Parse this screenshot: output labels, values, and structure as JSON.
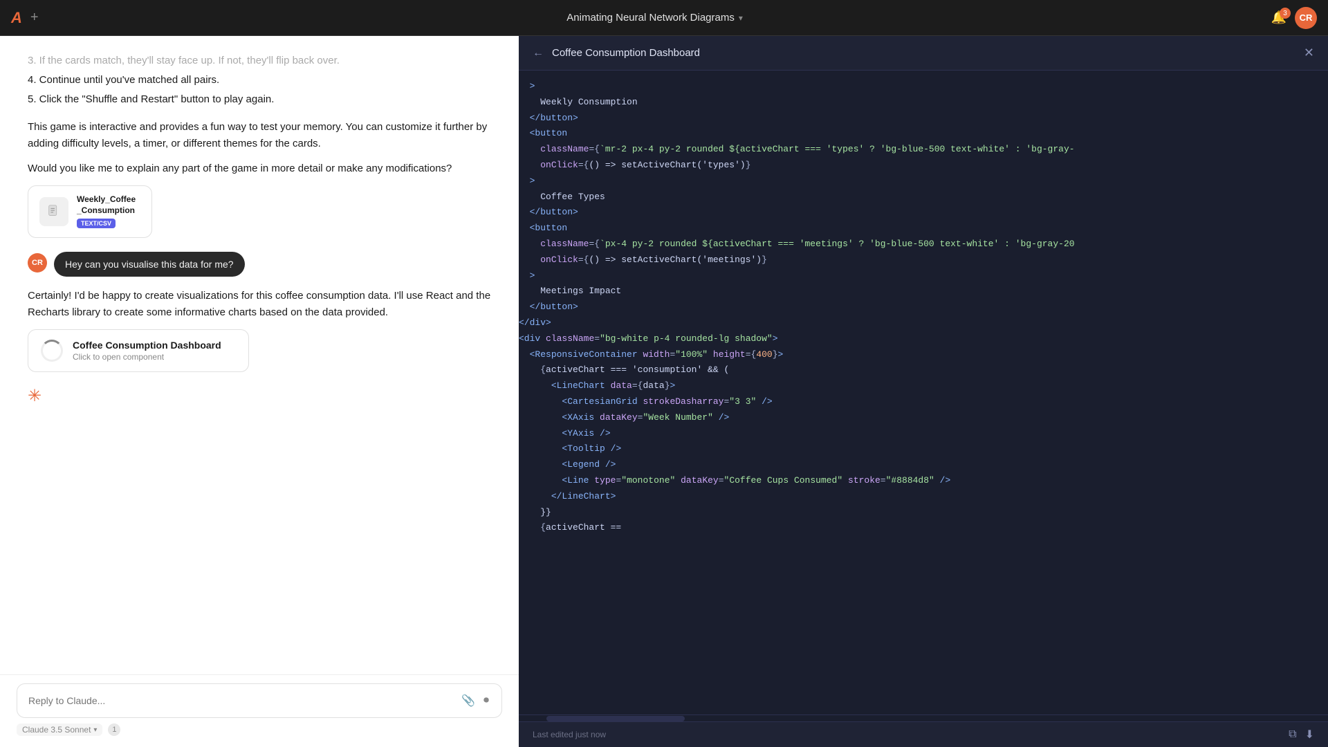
{
  "topbar": {
    "logo": "A",
    "plus_label": "+",
    "title": "Animating Neural Network Diagrams",
    "chevron": "▾",
    "notification_count": "3",
    "avatar_initials": "CR"
  },
  "chat": {
    "list_items": [
      "3. If the cards match, they'll stay face up. If not, they'll flip back over.",
      "4. Continue until you've matched all pairs.",
      "5. Click the \"Shuffle and Restart\" button to play again."
    ],
    "paragraph_1": "This game is interactive and provides a fun way to test your memory. You can customize it further by adding difficulty levels, a timer, or different themes for the cards.",
    "paragraph_2": "Would you like me to explain any part of the game in more detail or make any modifications?",
    "file_name": "Weekly_Coffee\n_Consumption",
    "file_badge": "TEXT/CSV",
    "user_message": "Hey can you visualise this data for me?",
    "user_initials": "CR",
    "response_text_1": "Certainly! I'd be happy to create visualizations for this coffee consumption data. I'll use React and the Recharts library to create some informative charts based on the data provided.",
    "component_title": "Coffee Consumption Dashboard",
    "component_subtitle": "Click to open component",
    "input_placeholder": "Reply to Claude...",
    "model_name": "Claude 3.5 Sonnet",
    "model_version": "1"
  },
  "code_panel": {
    "title": "Coffee Consumption Dashboard",
    "footer_text": "Last edited just now",
    "lines": [
      {
        "num": "",
        "content": "  >"
      },
      {
        "num": "",
        "content": "    Weekly Consumption"
      },
      {
        "num": "",
        "content": "  </button>"
      },
      {
        "num": "",
        "content": "  <button"
      },
      {
        "num": "",
        "content": "    className={`mr-2 px-4 py-2 rounded ${activeChart === 'types' ? 'bg-blue-500 text-white' : 'bg-gray-"
      },
      {
        "num": "",
        "content": "    onClick={() => setActiveChart('types')}"
      },
      {
        "num": "",
        "content": "  >"
      },
      {
        "num": "",
        "content": "    Coffee Types"
      },
      {
        "num": "",
        "content": "  </button>"
      },
      {
        "num": "",
        "content": "  <button"
      },
      {
        "num": "",
        "content": "    className={`px-4 py-2 rounded ${activeChart === 'meetings' ? 'bg-blue-500 text-white' : 'bg-gray-20"
      },
      {
        "num": "",
        "content": "    onClick={() => setActiveChart('meetings')}"
      },
      {
        "num": "",
        "content": "  >"
      },
      {
        "num": "",
        "content": "    Meetings Impact"
      },
      {
        "num": "",
        "content": "  </button>"
      },
      {
        "num": "",
        "content": "</div>"
      },
      {
        "num": "",
        "content": "<div className=\"bg-white p-4 rounded-lg shadow\">"
      },
      {
        "num": "",
        "content": "  <ResponsiveContainer width=\"100%\" height={400}>"
      },
      {
        "num": "",
        "content": "    {activeChart === 'consumption' && ("
      },
      {
        "num": "",
        "content": "      <LineChart data={data}>"
      },
      {
        "num": "",
        "content": "        <CartesianGrid strokeDasharray=\"3 3\" />"
      },
      {
        "num": "",
        "content": "        <XAxis dataKey=\"Week Number\" />"
      },
      {
        "num": "",
        "content": "        <YAxis />"
      },
      {
        "num": "",
        "content": "        <Tooltip />"
      },
      {
        "num": "",
        "content": "        <Legend />"
      },
      {
        "num": "",
        "content": "        <Line type=\"monotone\" dataKey=\"Coffee Cups Consumed\" stroke=\"#8884d8\" />"
      },
      {
        "num": "",
        "content": "      </LineChart>"
      },
      {
        "num": "",
        "content": "    }}"
      },
      {
        "num": "",
        "content": "    {activeChart =="
      }
    ]
  }
}
